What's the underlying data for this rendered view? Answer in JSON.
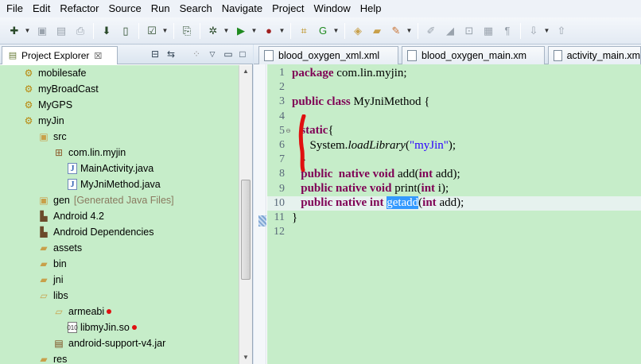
{
  "menu": [
    "File",
    "Edit",
    "Refactor",
    "Source",
    "Run",
    "Search",
    "Navigate",
    "Project",
    "Window",
    "Help"
  ],
  "project_explorer": {
    "title": "Project Explorer",
    "close_symbol": "☒",
    "items": [
      {
        "label": "mobilesafe",
        "icon": "android-project-icon",
        "indent": 0
      },
      {
        "label": "myBroadCast",
        "icon": "android-project-icon",
        "indent": 0
      },
      {
        "label": "MyGPS",
        "icon": "android-project-icon",
        "indent": 0
      },
      {
        "label": "myJin",
        "icon": "android-project-icon",
        "indent": 0
      },
      {
        "label": "src",
        "icon": "source-folder-icon",
        "indent": 1
      },
      {
        "label": "com.lin.myjin",
        "icon": "package-icon",
        "indent": 2
      },
      {
        "label": "MainActivity.java",
        "icon": "java-file-icon",
        "indent": 3
      },
      {
        "label": "MyJniMethod.java",
        "icon": "java-file-icon",
        "indent": 3
      },
      {
        "label": "gen",
        "icon": "source-folder-icon",
        "indent": 1,
        "suffix": "[Generated Java Files]"
      },
      {
        "label": "Android 4.2",
        "icon": "library-icon",
        "indent": 1
      },
      {
        "label": "Android Dependencies",
        "icon": "library-icon",
        "indent": 1
      },
      {
        "label": "assets",
        "icon": "folder-icon",
        "indent": 1
      },
      {
        "label": "bin",
        "icon": "folder-icon",
        "indent": 1
      },
      {
        "label": "jni",
        "icon": "folder-icon",
        "indent": 1
      },
      {
        "label": "libs",
        "icon": "folder-open-icon",
        "indent": 1
      },
      {
        "label": "armeabi",
        "icon": "folder-open-icon",
        "indent": 2,
        "marked": true
      },
      {
        "label": "libmyJin.so",
        "icon": "binary-file-icon",
        "indent": 3,
        "marked": true
      },
      {
        "label": "android-support-v4.jar",
        "icon": "jar-icon",
        "indent": 2
      },
      {
        "label": "res",
        "icon": "folder-icon",
        "indent": 1
      }
    ]
  },
  "editor": {
    "tabs": [
      "blood_oxygen_xml.xml",
      "blood_oxygen_main.xm",
      "activity_main.xm"
    ],
    "current_line": 10,
    "lines": [
      {
        "n": "1",
        "html_parts": [
          [
            "kw",
            "package"
          ],
          [
            "t",
            " com.lin.myjin;"
          ]
        ]
      },
      {
        "n": "2",
        "html_parts": []
      },
      {
        "n": "3",
        "html_parts": [
          [
            "kw",
            "public class"
          ],
          [
            "t",
            " MyJniMethod {"
          ]
        ]
      },
      {
        "n": "4",
        "html_parts": []
      },
      {
        "n": "5",
        "html_parts": [
          [
            "t",
            "   "
          ],
          [
            "kw",
            "static"
          ],
          [
            "t",
            "{"
          ]
        ],
        "fold": "⊖"
      },
      {
        "n": "6",
        "html_parts": [
          [
            "t",
            "      System."
          ],
          [
            "it",
            "loadLibrary"
          ],
          [
            "t",
            "("
          ],
          [
            "str",
            "\"myJin\""
          ],
          [
            "t",
            ");"
          ]
        ]
      },
      {
        "n": "7",
        "html_parts": [
          [
            "t",
            "   }"
          ]
        ]
      },
      {
        "n": "8",
        "html_parts": [
          [
            "t",
            "   "
          ],
          [
            "kw",
            "public  native void"
          ],
          [
            "t",
            " add("
          ],
          [
            "kw",
            "int"
          ],
          [
            "t",
            " add);"
          ]
        ]
      },
      {
        "n": "9",
        "html_parts": [
          [
            "t",
            "   "
          ],
          [
            "kw",
            "public native void"
          ],
          [
            "t",
            " print("
          ],
          [
            "kw",
            "int"
          ],
          [
            "t",
            " i);"
          ]
        ]
      },
      {
        "n": "10",
        "html_parts": [
          [
            "t",
            "   "
          ],
          [
            "kw",
            "public native int"
          ],
          [
            "t",
            " "
          ],
          [
            "sel",
            "getadd"
          ],
          [
            "t",
            "("
          ],
          [
            "kw",
            "int"
          ],
          [
            "t",
            " add);"
          ]
        ]
      },
      {
        "n": "11",
        "html_parts": [
          [
            "t",
            "}"
          ]
        ]
      },
      {
        "n": "12",
        "html_parts": []
      }
    ]
  },
  "colors": {
    "background_green": "#c6edc9",
    "keyword": "#7f0055",
    "string": "#2a00ff",
    "selection": "#3399ff",
    "annotation_red": "#e01010"
  }
}
